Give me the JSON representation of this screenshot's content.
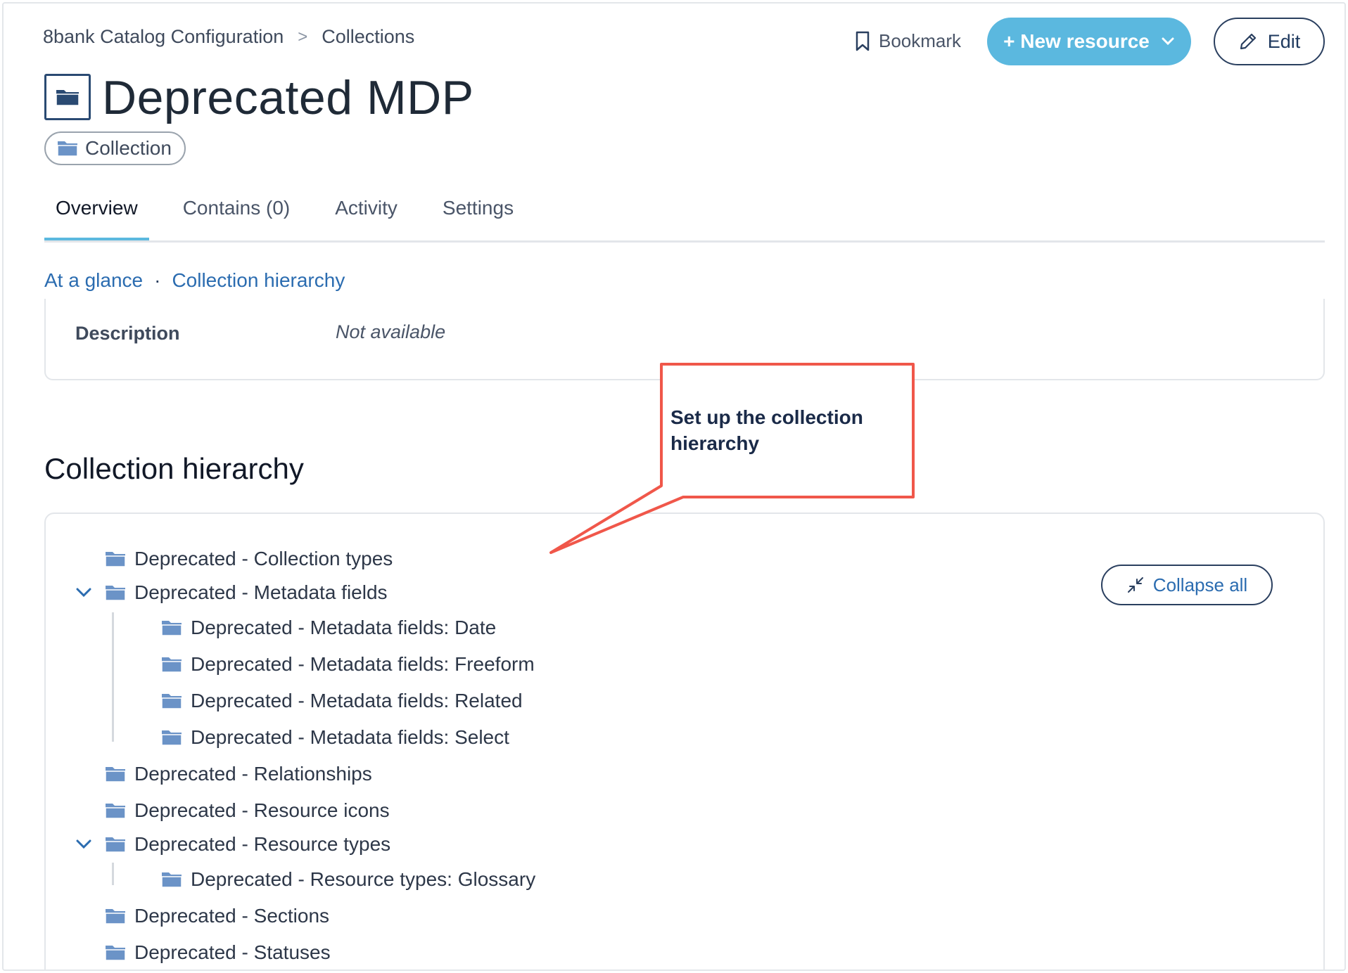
{
  "breadcrumb": {
    "items": [
      "8bank Catalog Configuration",
      "Collections"
    ],
    "separator": ">"
  },
  "header": {
    "bookmark_label": "Bookmark",
    "new_resource_label": "+ New resource",
    "edit_label": "Edit",
    "title": "Deprecated MDP",
    "type_chip": "Collection"
  },
  "tabs": [
    {
      "label": "Overview",
      "active": true
    },
    {
      "label": "Contains (0)",
      "active": false
    },
    {
      "label": "Activity",
      "active": false
    },
    {
      "label": "Settings",
      "active": false
    }
  ],
  "subnav": {
    "items": [
      "At a glance",
      "Collection hierarchy"
    ],
    "separator": "·"
  },
  "description": {
    "label": "Description",
    "value": "Not available"
  },
  "hierarchy": {
    "title": "Collection hierarchy",
    "collapse_all_label": "Collapse all",
    "items": [
      {
        "label": "Deprecated - Collection types",
        "level": 0,
        "expanded": null
      },
      {
        "label": "Deprecated - Metadata fields",
        "level": 0,
        "expanded": true
      },
      {
        "label": "Deprecated - Metadata fields: Date",
        "level": 1,
        "expanded": null
      },
      {
        "label": "Deprecated - Metadata fields: Freeform",
        "level": 1,
        "expanded": null
      },
      {
        "label": "Deprecated - Metadata fields: Related",
        "level": 1,
        "expanded": null
      },
      {
        "label": "Deprecated - Metadata fields: Select",
        "level": 1,
        "expanded": null
      },
      {
        "label": "Deprecated - Relationships",
        "level": 0,
        "expanded": null
      },
      {
        "label": "Deprecated - Resource icons",
        "level": 0,
        "expanded": null
      },
      {
        "label": "Deprecated - Resource types",
        "level": 0,
        "expanded": true
      },
      {
        "label": "Deprecated - Resource types: Glossary",
        "level": 1,
        "expanded": null
      },
      {
        "label": "Deprecated - Sections",
        "level": 0,
        "expanded": null
      },
      {
        "label": "Deprecated - Statuses",
        "level": 0,
        "expanded": null
      }
    ]
  },
  "annotation": {
    "text": "Set up the collection hierarchy",
    "color": "#f0574a"
  },
  "colors": {
    "accent": "#5bb8df",
    "link": "#2b6cb0",
    "folder": "#6b93c7",
    "dark": "#2a3f5f"
  },
  "icons": [
    "bookmark-icon",
    "chevron-down-icon",
    "pencil-icon",
    "folder-icon",
    "collapse-arrows-icon"
  ]
}
